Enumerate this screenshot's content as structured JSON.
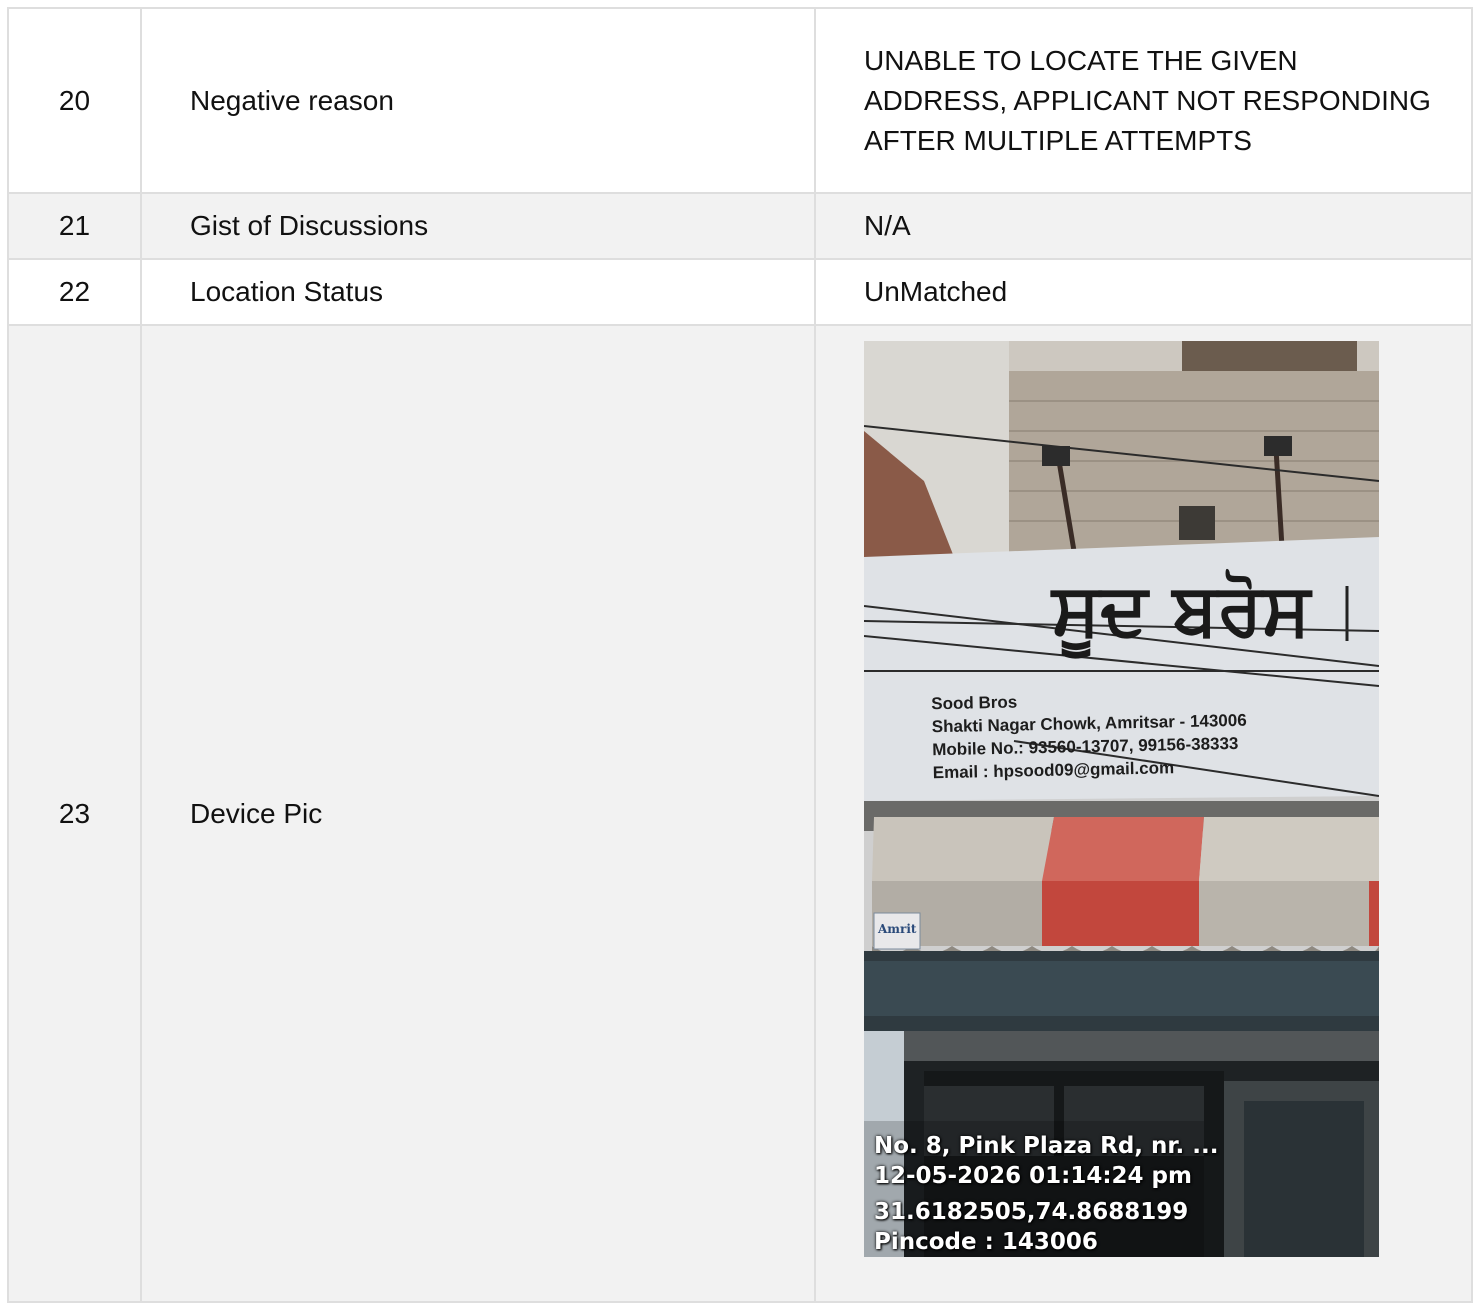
{
  "rows": [
    {
      "num": "20",
      "label": "Negative reason",
      "value": "UNABLE TO LOCATE THE GIVEN ADDRESS, APPLICANT NOT RESPONDING AFTER MULTIPLE ATTEMPTS"
    },
    {
      "num": "21",
      "label": "Gist of Discussions",
      "value": "N/A"
    },
    {
      "num": "22",
      "label": "Location Status",
      "value": "UnMatched"
    },
    {
      "num": "23",
      "label": "Device Pic"
    }
  ],
  "photo": {
    "sign_script": "ਸੂਦ ਬਰੋਸ",
    "sign_lines": [
      "Sood Bros",
      "Shakti Nagar Chowk, Amritsar - 143006",
      "Mobile No.: 93560-13707, 99156-38333",
      "Email : hpsood09@gmail.com"
    ],
    "stamp": {
      "address": "No. 8, Pink Plaza Rd, nr. ...",
      "datetime": "12-05-2026 01:14:24 pm",
      "coords": "31.6182505,74.8688199",
      "pincode": "Pincode : 143006"
    },
    "logo_text": "Amrit"
  }
}
